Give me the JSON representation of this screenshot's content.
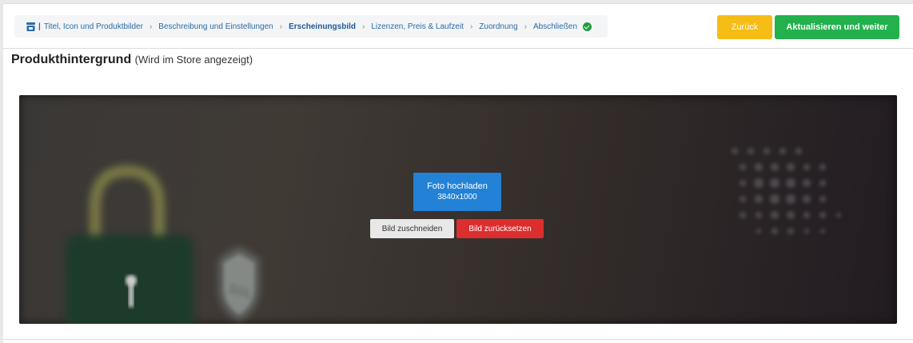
{
  "breadcrumb": {
    "items": [
      {
        "label": "Titel, Icon und Produktbilder",
        "active": false
      },
      {
        "label": "Beschreibung und Einstellungen",
        "active": false
      },
      {
        "label": "Erscheinungsbild",
        "active": true
      },
      {
        "label": "Lizenzen, Preis & Laufzeit",
        "active": false
      },
      {
        "label": "Zuordnung",
        "active": false
      },
      {
        "label": "Abschließen",
        "active": false
      }
    ],
    "icons": {
      "first": "store-icon",
      "last": "check-circle-icon",
      "separator": "chevron-right-icon"
    }
  },
  "actions": {
    "back_label": "Zurück",
    "next_label": "Aktualisieren und weiter"
  },
  "section": {
    "title": "Produkthintergrund",
    "subtitle": "(Wird im Store angezeigt)"
  },
  "banner": {
    "upload_label": "Foto hochladen",
    "upload_dimensions": "3840x1000",
    "crop_label": "Bild zuschneiden",
    "reset_label": "Bild zurücksetzen",
    "image_badge_text": "SSL"
  },
  "colors": {
    "back": "#f5bc15",
    "next": "#22b14c",
    "upload": "#2382d6",
    "reset": "#dc2e2e",
    "link": "#2a6ba8"
  }
}
